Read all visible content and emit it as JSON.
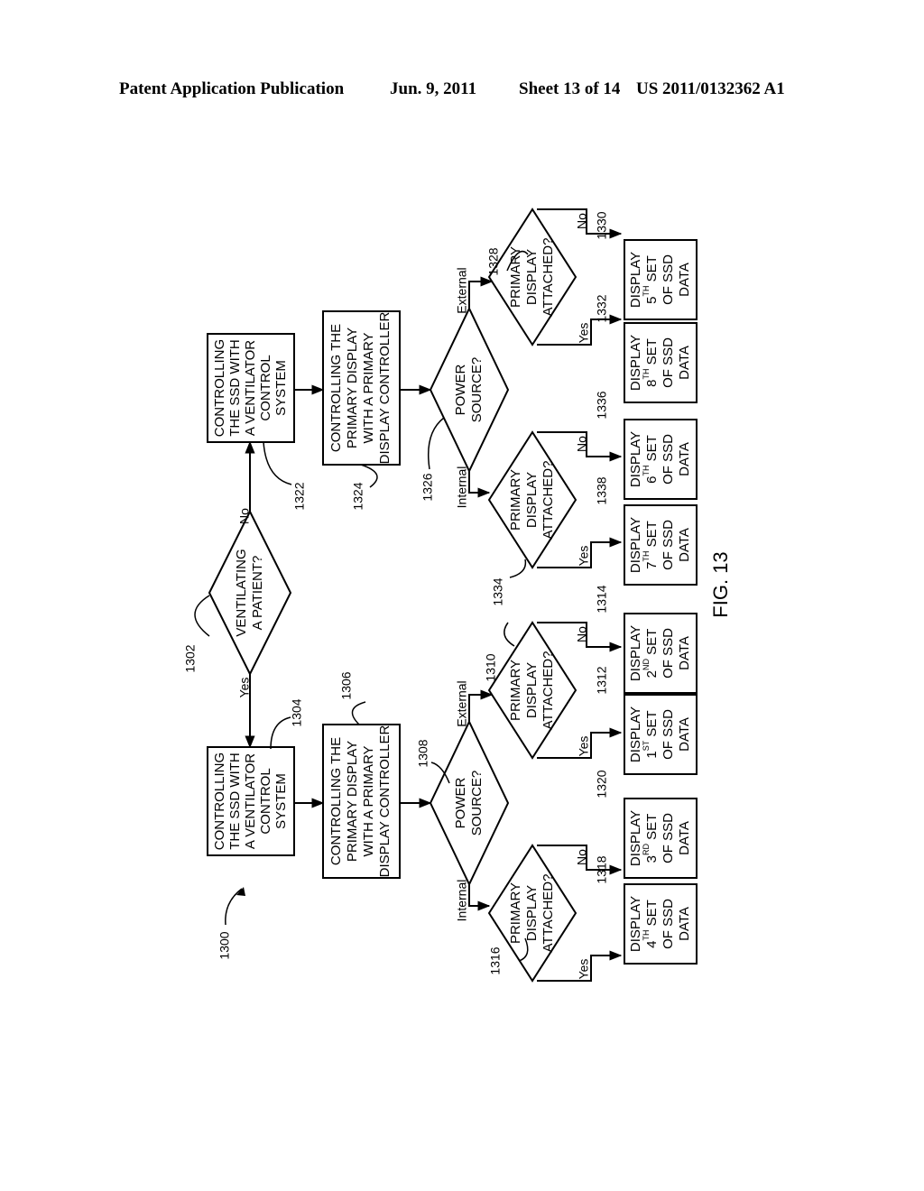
{
  "header": {
    "publication": "Patent Application Publication",
    "date": "Jun. 9, 2011",
    "sheet": "Sheet 13 of 14",
    "number": "US 2011/0132362 A1"
  },
  "figure": {
    "label": "FIG. 13",
    "ref": "1300",
    "decision_ventilating": {
      "ref": "1302",
      "lines": [
        "VENTILATING",
        "A PATIENT?"
      ],
      "yes": "Yes",
      "no": "No"
    },
    "left_branch": {
      "ssd_box": {
        "ref": "1304",
        "lines": [
          "CONTROLLING",
          "THE SSD WITH",
          "A VENTILATOR",
          "CONTROL",
          "SYSTEM"
        ]
      },
      "primary_box": {
        "ref": "1306",
        "lines": [
          "CONTROLLING THE",
          "PRIMARY DISPLAY",
          "WITH A PRIMARY",
          "DISPLAY CONTROLLER"
        ]
      },
      "power": {
        "ref": "1308",
        "lines": [
          "POWER",
          "SOURCE?"
        ],
        "external": "External",
        "internal": "Internal"
      },
      "ext_attached": {
        "ref": "1310",
        "lines": [
          "PRIMARY",
          "DISPLAY",
          "ATTACHED?"
        ],
        "yes": "Yes",
        "no": "No"
      },
      "int_attached": {
        "ref": "1316",
        "lines": [
          "PRIMARY",
          "DISPLAY",
          "ATTACHED?"
        ],
        "yes": "Yes",
        "no": "No"
      },
      "out_1312": {
        "ref": "1312",
        "lines": [
          "DISPLAY",
          "1ST SET",
          "OF SSD",
          "DATA"
        ],
        "sup": "ST",
        "ordinal": "1"
      },
      "out_1314": {
        "ref": "1314",
        "lines": [
          "DISPLAY",
          "2ND SET",
          "OF SSD",
          "DATA"
        ],
        "sup": "ND",
        "ordinal": "2"
      },
      "out_1320": {
        "ref": "1320",
        "lines": [
          "DISPLAY",
          "3RD SET",
          "OF SSD",
          "DATA"
        ],
        "sup": "RD",
        "ordinal": "3"
      },
      "out_1318": {
        "ref": "1318",
        "lines": [
          "DISPLAY",
          "4TH SET",
          "OF SSD",
          "DATA"
        ],
        "sup": "TH",
        "ordinal": "4"
      }
    },
    "right_branch": {
      "ssd_box": {
        "ref": "1322",
        "lines": [
          "CONTROLLING",
          "THE SSD WITH",
          "A VENTILATOR",
          "CONTROL",
          "SYSTEM"
        ]
      },
      "primary_box": {
        "ref": "1324",
        "lines": [
          "CONTROLLING THE",
          "PRIMARY DISPLAY",
          "WITH A PRIMARY",
          "DISPLAY CONTROLLER"
        ]
      },
      "power": {
        "ref": "1326",
        "lines": [
          "POWER",
          "SOURCE?"
        ],
        "external": "External",
        "internal": "Internal"
      },
      "ext_attached": {
        "ref": "1328",
        "lines": [
          "PRIMARY",
          "DISPLAY",
          "ATTACHED?"
        ],
        "yes": "Yes",
        "no": "No"
      },
      "int_attached": {
        "ref": "1334",
        "lines": [
          "PRIMARY",
          "DISPLAY",
          "ATTACHED?"
        ],
        "yes": "Yes",
        "no": "No"
      },
      "out_1330": {
        "ref": "1330",
        "sup": "TH",
        "ordinal": "5"
      },
      "out_1332": {
        "ref": "1332",
        "sup": "TH",
        "ordinal": "8"
      },
      "out_1336": {
        "ref": "1336",
        "sup": "TH",
        "ordinal": "6"
      },
      "out_1338": {
        "ref": "1338",
        "sup": "TH",
        "ordinal": "7"
      }
    },
    "display_words": {
      "display": "DISPLAY",
      "set": "SET",
      "of_ssd": "OF SSD",
      "data": "DATA"
    }
  }
}
